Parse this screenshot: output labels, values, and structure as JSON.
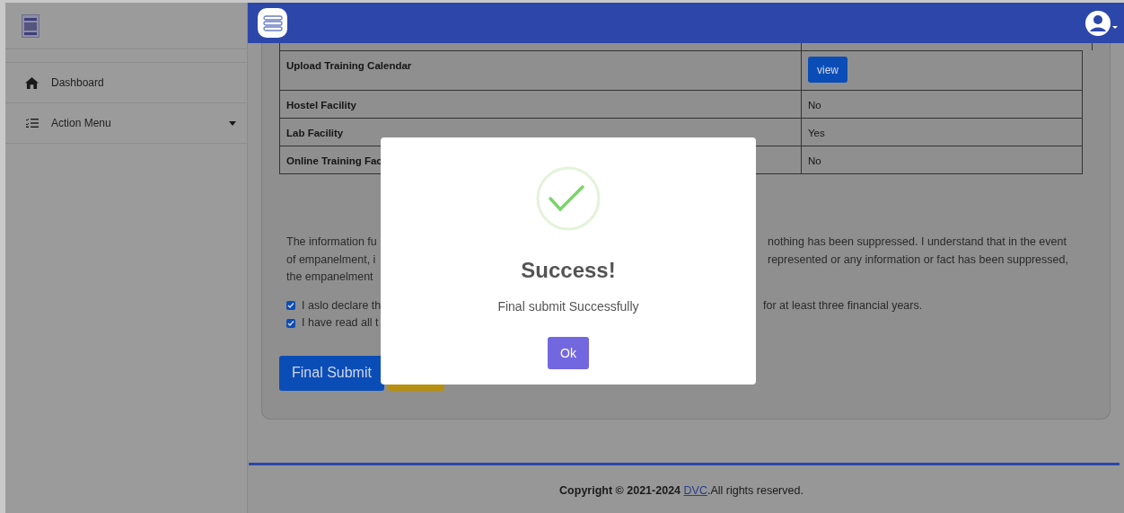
{
  "sidebar": {
    "items": [
      {
        "label": "Dashboard",
        "kind": "link"
      },
      {
        "label": "Action Menu",
        "kind": "dropdown"
      }
    ]
  },
  "table": {
    "rows": [
      {
        "label": "Upload Training Calendar",
        "kind": "button",
        "value": "view"
      },
      {
        "label": "Hostel Facility",
        "kind": "text",
        "value": "No"
      },
      {
        "label": "Lab Facility",
        "kind": "text",
        "value": "Yes"
      },
      {
        "label": "Online Training Fac",
        "kind": "text",
        "value": "No"
      }
    ]
  },
  "declaration": {
    "left_lines": [
      "The information fu",
      "of empanelment, i",
      "the empanelment"
    ],
    "right_lines": [
      "nothing has been suppressed. I understand that in the event",
      "represented or any information or fact has been suppressed,"
    ]
  },
  "checkboxes": [
    {
      "left": "I aslo declare th",
      "right": "for at least three financial years.",
      "checked": true
    },
    {
      "left": "I have read all t",
      "checked": true
    }
  ],
  "buttons": {
    "final_submit": "Final Submit"
  },
  "footer": {
    "prefix": "Copyright © 2021-2024 ",
    "link": "DVC",
    "suffix": ".All rights reserved."
  },
  "modal": {
    "title": "Success!",
    "message": "Final submit Successfully",
    "ok": "Ok"
  }
}
